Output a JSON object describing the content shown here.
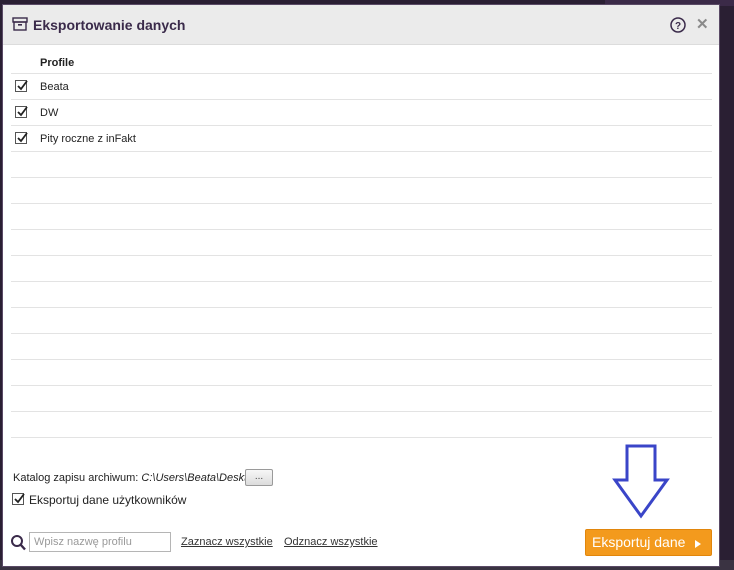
{
  "dialog": {
    "title": "Eksportowanie danych",
    "help_glyph": "?",
    "close_glyph": "✕"
  },
  "table": {
    "header": "Profile",
    "rows": [
      {
        "label": "Beata",
        "checked": true
      },
      {
        "label": "DW",
        "checked": true
      },
      {
        "label": "Pity roczne z inFakt",
        "checked": true
      }
    ],
    "empty_rows": 11
  },
  "footer": {
    "catalog_label": "Katalog zapisu archiwum:",
    "catalog_path": "C:\\Users\\Beata\\Desktop",
    "browse_label": "...",
    "export_users_label": "Eksportuj dane użytkowników",
    "export_users_checked": true,
    "search_placeholder": "Wpisz nazwę profilu",
    "select_all": "Zaznacz wszystkie",
    "deselect_all": "Odznacz wszystkie",
    "export_button": "Eksportuj dane"
  },
  "colors": {
    "accent_orange": "#f39a1d",
    "annotation_arrow": "#3a45c8",
    "title_text": "#3a2a4a"
  },
  "icons": {
    "title": "archive-box-icon",
    "help": "question-circle-icon",
    "close": "close-icon",
    "search": "magnifier-icon",
    "export": "play-triangle-icon"
  }
}
